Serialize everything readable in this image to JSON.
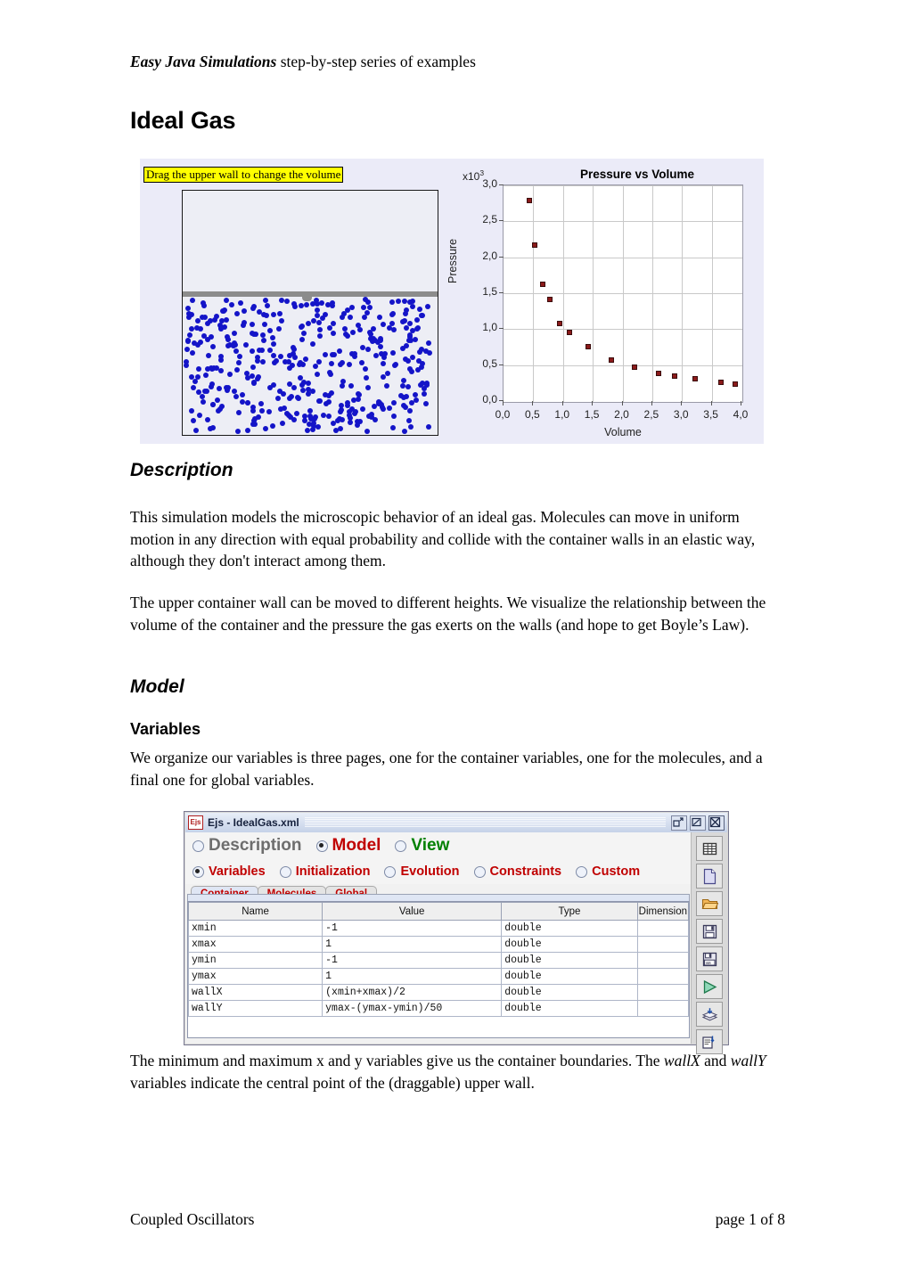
{
  "document": {
    "running_header_bold": "Easy Java Simulations",
    "running_header_rest": " step-by-step series of examples",
    "title": "Ideal Gas",
    "footer_left": "Coupled Oscillators",
    "footer_right": "page 1 of  8"
  },
  "figure_simulation": {
    "tooltip": "Drag the upper wall to change the volume",
    "colors": {
      "panel_background": "#ebebf8",
      "container_fill": "#edeef5",
      "molecule": "#1414c8",
      "piston": "#8c8c8c",
      "tooltip_background": "#ffff00"
    }
  },
  "chart_data": {
    "type": "scatter",
    "title": "Pressure vs Volume",
    "xlabel": "Volume",
    "ylabel": "Pressure",
    "y_multiplier": "x10",
    "y_multiplier_exp": "3",
    "xlim": [
      0.0,
      4.0
    ],
    "ylim": [
      0.0,
      3.0
    ],
    "xticks": [
      "0,0",
      "0,5",
      "1,0",
      "1,5",
      "2,0",
      "2,5",
      "3,0",
      "3,5",
      "4,0"
    ],
    "xtick_values": [
      0.0,
      0.5,
      1.0,
      1.5,
      2.0,
      2.5,
      3.0,
      3.5,
      4.0
    ],
    "yticks": [
      "0,0",
      "0,5",
      "1,0",
      "1,5",
      "2,0",
      "2,5",
      "3,0"
    ],
    "ytick_values": [
      0.0,
      0.5,
      1.0,
      1.5,
      2.0,
      2.5,
      3.0
    ],
    "grid": true,
    "legend": "none",
    "marker_color": "#8b1a1a",
    "x": [
      0.44,
      0.52,
      0.66,
      0.78,
      0.95,
      1.11,
      1.42,
      1.81,
      2.2,
      2.6,
      2.88,
      3.22,
      3.66,
      3.9
    ],
    "y": [
      2.79,
      2.17,
      1.62,
      1.41,
      1.08,
      0.95,
      0.755,
      0.575,
      0.47,
      0.385,
      0.35,
      0.31,
      0.26,
      0.235
    ],
    "points": [
      {
        "volume": 0.44,
        "pressure": 2.79
      },
      {
        "volume": 0.52,
        "pressure": 2.17
      },
      {
        "volume": 0.66,
        "pressure": 1.62
      },
      {
        "volume": 0.78,
        "pressure": 1.41
      },
      {
        "volume": 0.95,
        "pressure": 1.08
      },
      {
        "volume": 1.11,
        "pressure": 0.95
      },
      {
        "volume": 1.42,
        "pressure": 0.755
      },
      {
        "volume": 1.81,
        "pressure": 0.575
      },
      {
        "volume": 2.2,
        "pressure": 0.47
      },
      {
        "volume": 2.6,
        "pressure": 0.385
      },
      {
        "volume": 2.88,
        "pressure": 0.35
      },
      {
        "volume": 3.22,
        "pressure": 0.31
      },
      {
        "volume": 3.66,
        "pressure": 0.26
      },
      {
        "volume": 3.9,
        "pressure": 0.235
      }
    ]
  },
  "sections": {
    "description_heading": "Description",
    "description_p1": "This simulation models the microscopic behavior of an ideal gas. Molecules can move in uniform motion in any direction with equal probability and collide with the container walls in an elastic way, although they don't interact among them.",
    "description_p2": "The upper container wall can be moved to different heights. We visualize the relationship between the volume of the container and the pressure the gas exerts on the walls (and hope to get Boyle’s Law).",
    "model_heading": "Model",
    "variables_heading": "Variables",
    "variables_p1": "We organize our variables is three pages, one for the container variables, one for the molecules, and a final one for global variables.",
    "after_fig_p1_a": "The minimum and maximum x and y variables give us the container boundaries. The ",
    "after_fig_p1_i1": "wallX",
    "after_fig_p1_b": " and ",
    "after_fig_p1_i2": "wallY",
    "after_fig_p1_c": " variables indicate the central point of the (draggable) upper wall."
  },
  "ejs_dialog": {
    "app_icon_text": "Ejs",
    "title": "Ejs - IdealGas.xml",
    "window_buttons": [
      "restore-button",
      "maximize-button",
      "close-button"
    ],
    "main_tabs": [
      {
        "label": "Description",
        "selected": false,
        "color": "gray"
      },
      {
        "label": "Model",
        "selected": true,
        "color": "red"
      },
      {
        "label": "View",
        "selected": false,
        "color": "green"
      }
    ],
    "sub_tabs": [
      {
        "label": "Variables",
        "selected": true
      },
      {
        "label": "Initialization",
        "selected": false
      },
      {
        "label": "Evolution",
        "selected": false
      },
      {
        "label": "Constraints",
        "selected": false
      },
      {
        "label": "Custom",
        "selected": false
      }
    ],
    "page_tabs": [
      {
        "label": "Container",
        "active": true
      },
      {
        "label": "Molecules",
        "active": false
      },
      {
        "label": "Global",
        "active": false
      }
    ],
    "table": {
      "headers": [
        "Name",
        "Value",
        "Type",
        "Dimension"
      ],
      "rows": [
        {
          "name": "xmin",
          "value": "-1",
          "type": "double",
          "dimension": ""
        },
        {
          "name": "xmax",
          "value": "1",
          "type": "double",
          "dimension": ""
        },
        {
          "name": "ymin",
          "value": "-1",
          "type": "double",
          "dimension": ""
        },
        {
          "name": "ymax",
          "value": "1",
          "type": "double",
          "dimension": ""
        },
        {
          "name": "wallX",
          "value": "(xmin+xmax)/2",
          "type": "double",
          "dimension": ""
        },
        {
          "name": "wallY",
          "value": "ymax-(ymax-ymin)/50",
          "type": "double",
          "dimension": ""
        }
      ]
    },
    "toolbar_icons": [
      "table-grid-icon",
      "new-page-icon",
      "open-folder-icon",
      "save-icon",
      "save-as-icon",
      "run-icon",
      "package-icon",
      "export-icon"
    ]
  }
}
